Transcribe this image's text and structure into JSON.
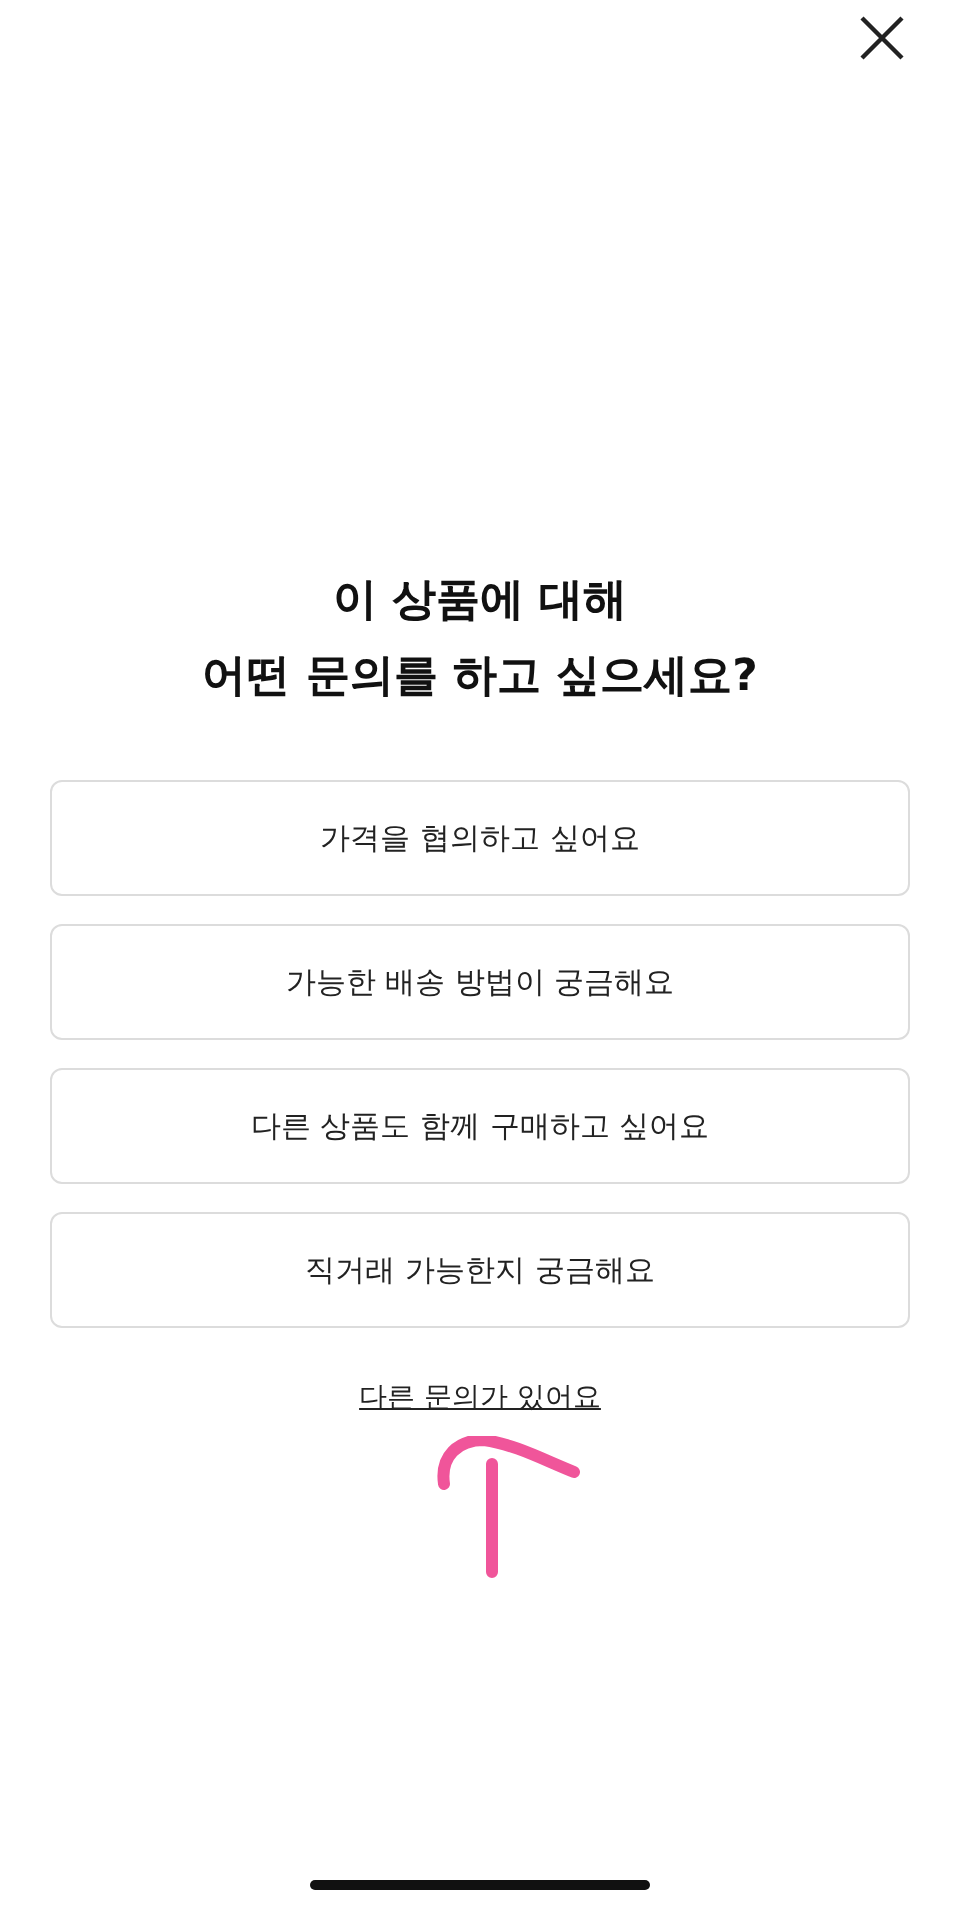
{
  "title_lines": [
    "이 상품에 대해",
    "어떤 문의를 하고 싶으세요?"
  ],
  "options": [
    "가격을 협의하고 싶어요",
    "가능한 배송 방법이 궁금해요",
    "다른 상품도 함께 구매하고 싶어요",
    "직거래 가능한지 궁금해요"
  ],
  "other_link": "다른 문의가 있어요"
}
